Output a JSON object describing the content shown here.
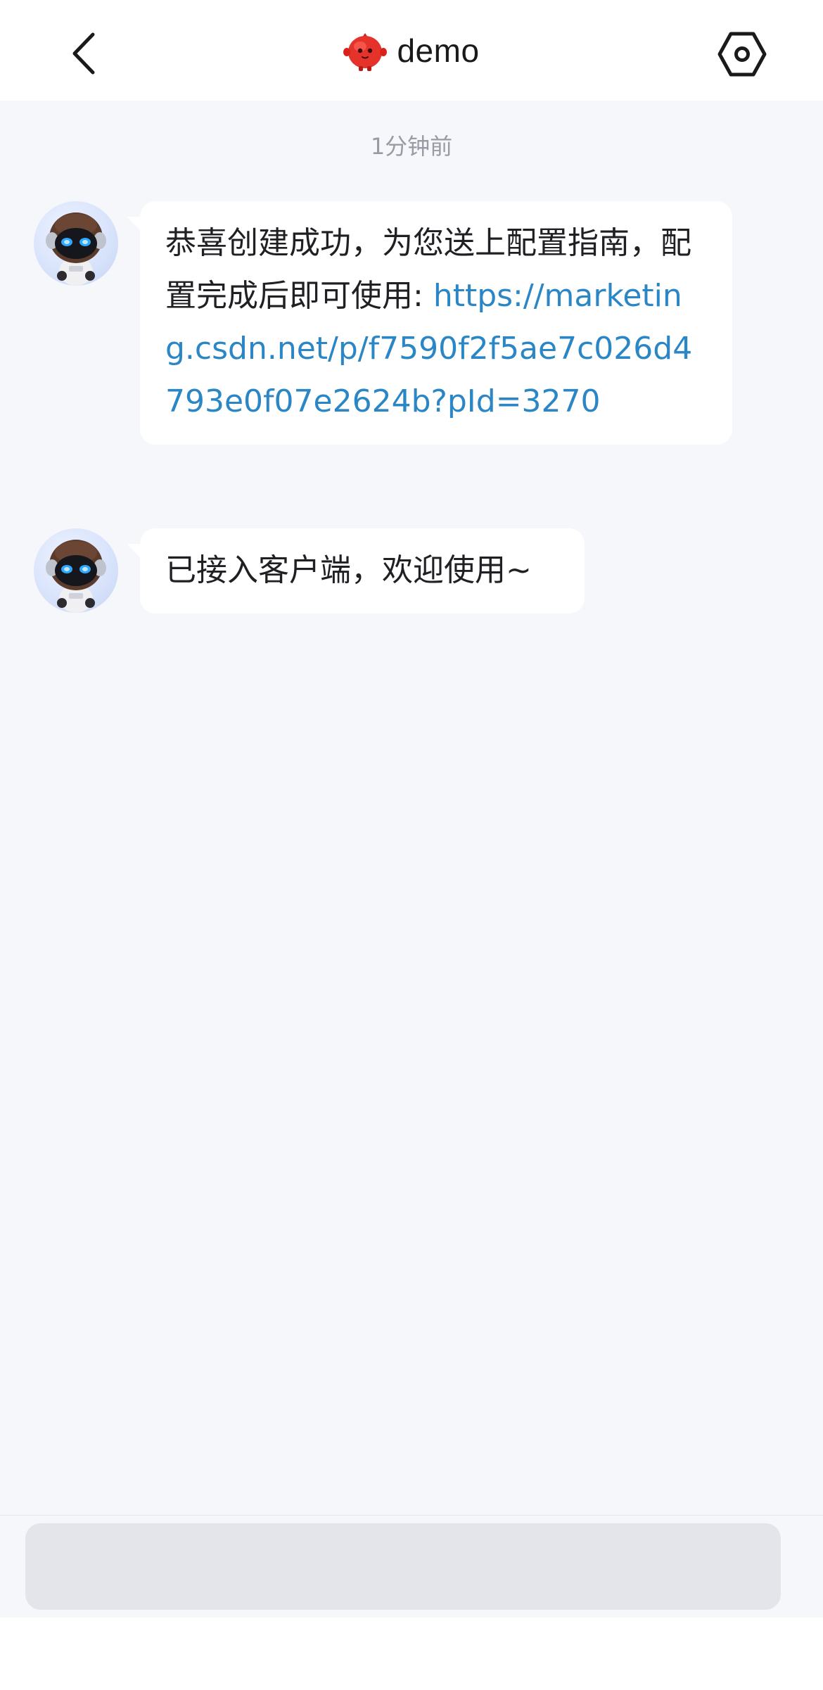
{
  "header": {
    "title": "demo",
    "back_icon": "chevron-left-icon",
    "logo_icon": "red-mascot-logo",
    "settings_icon": "hexagon-settings-icon"
  },
  "chat": {
    "timestamp": "1分钟前",
    "messages": [
      {
        "sender_avatar": "robot-avatar",
        "text_before_link": "恭喜创建成功，为您送上配置指南，配置完成后即可使用: ",
        "link": "https://marketing.csdn.net/p/f7590f2f5ae7c026d4793e0f07e2624b?pId=3270"
      },
      {
        "sender_avatar": "robot-avatar",
        "text": "已接入客户端，欢迎使用~"
      }
    ]
  },
  "input": {
    "placeholder": "",
    "value": ""
  },
  "colors": {
    "chat_background": "#f6f7fb",
    "bubble": "#ffffff",
    "link": "#2b86c5",
    "input": "#e4e5ea"
  }
}
